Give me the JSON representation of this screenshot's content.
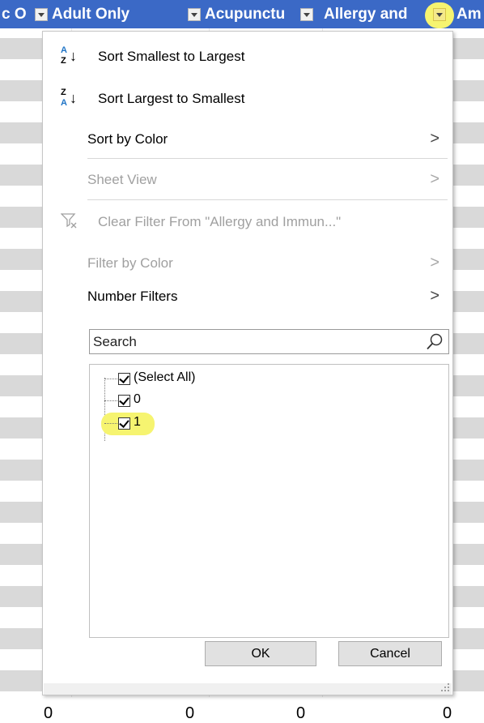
{
  "header_cells": [
    {
      "label": "c O",
      "accent": false
    },
    {
      "label": "Adult Only",
      "accent": false
    },
    {
      "label": "Acupunctu",
      "accent": false
    },
    {
      "label": "Allergy and",
      "accent": true
    },
    {
      "label": "Am",
      "accent": false
    }
  ],
  "bottom_values": [
    "0",
    "0",
    "0",
    "0"
  ],
  "menu": {
    "sort_asc": "Sort Smallest to Largest",
    "sort_desc": "Sort Largest to Smallest",
    "sort_by_color": "Sort by Color",
    "sheet_view": "Sheet View",
    "clear_filter": "Clear Filter From \"Allergy and Immun...\"",
    "filter_by_color": "Filter by Color",
    "number_filters": "Number Filters",
    "submenu_arrow": ">",
    "search_placeholder": "Search",
    "items": [
      {
        "label": "(Select All)",
        "checked": true,
        "highlighted": false
      },
      {
        "label": "0",
        "checked": true,
        "highlighted": false
      },
      {
        "label": "1",
        "checked": true,
        "highlighted": true
      }
    ],
    "ok_label": "OK",
    "cancel_label": "Cancel"
  },
  "colors": {
    "header_blue": "#3b69c6",
    "stripe_gray": "#d9d9d9",
    "highlight_yellow": "#f6f470",
    "sort_letter_blue": "#1f74c6"
  },
  "icons": [
    "sort-ascending-icon",
    "sort-descending-icon",
    "clear-filter-icon",
    "search-icon",
    "filter-dropdown-icon",
    "resize-grip-icon"
  ]
}
